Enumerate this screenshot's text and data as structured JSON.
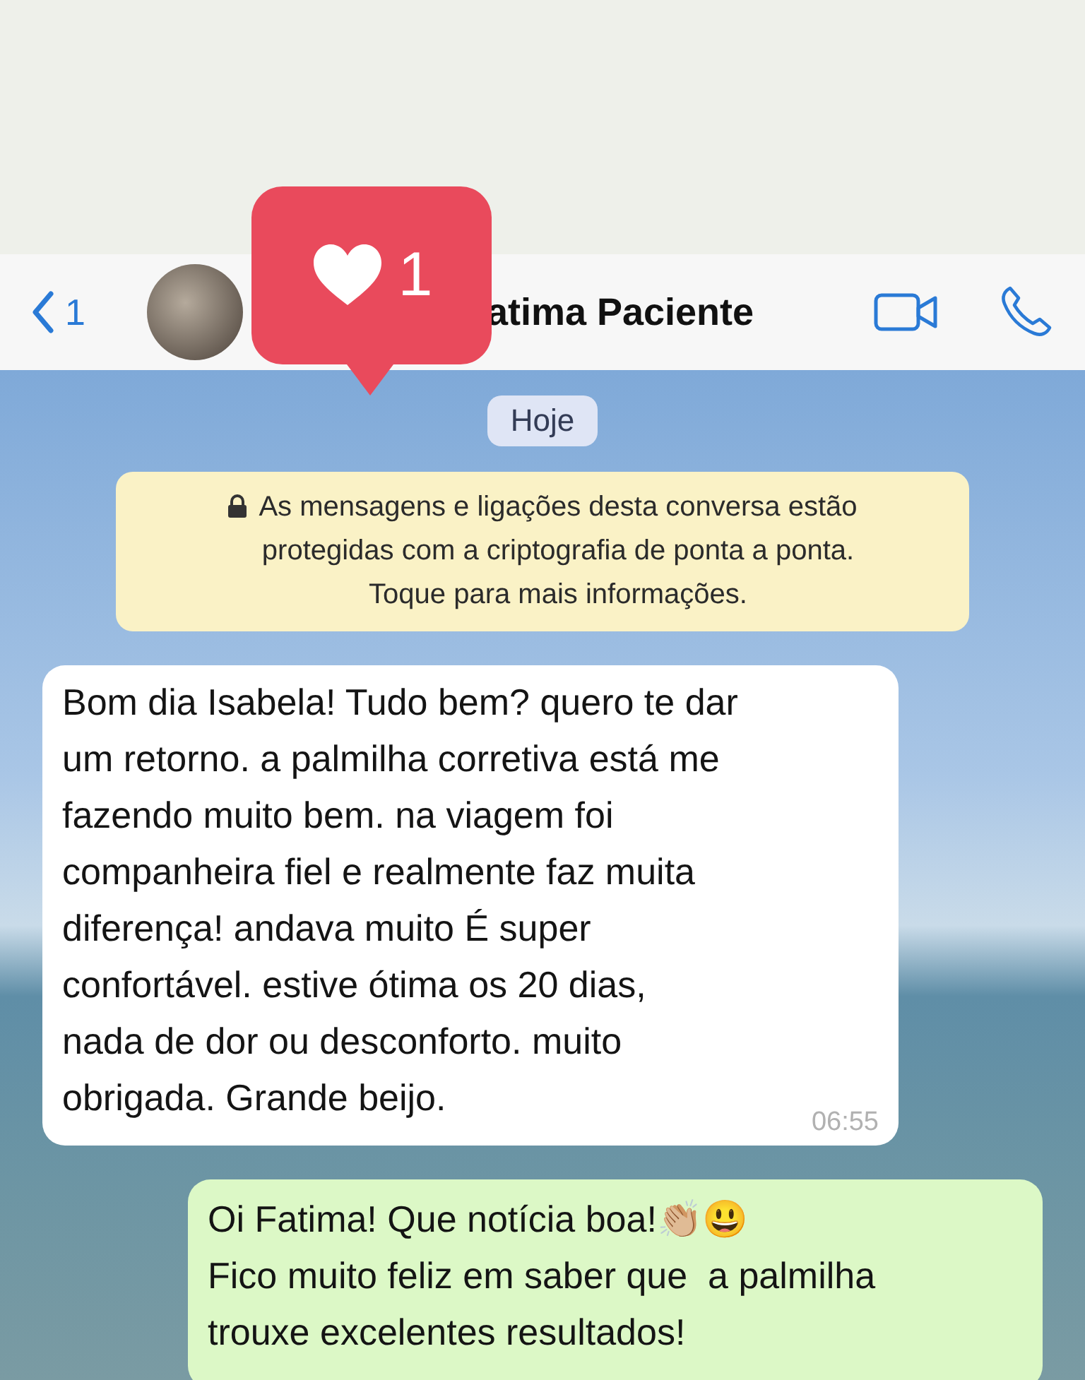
{
  "header": {
    "back_count": "1",
    "contact_name": "atima Paciente"
  },
  "notification": {
    "count": "1"
  },
  "date_chip": "Hoje",
  "encryption_notice": "As mensagens e ligações desta conversa estão\nprotegidas com a criptografia de ponta a ponta.\nToque para mais informações.",
  "messages": [
    {
      "kind": "incoming",
      "text": "Bom dia Isabela! Tudo bem? quero te dar\num retorno. a palmilha corretiva está me\nfazendo muito bem. na viagem foi\ncompanheira fiel e realmente faz muita\ndiferença! andava muito É super\nconfortável. estive ótima os 20 dias,\nnada de dor ou desconforto. muito\nobrigada. Grande beijo.",
      "time": "06:55"
    },
    {
      "kind": "outgoing",
      "text": "Oi Fatima! Que notícia boa!👏🏼😃\nFico muito feliz em saber que  a palmilha\ntrouxe excelentes resultados!"
    }
  ]
}
